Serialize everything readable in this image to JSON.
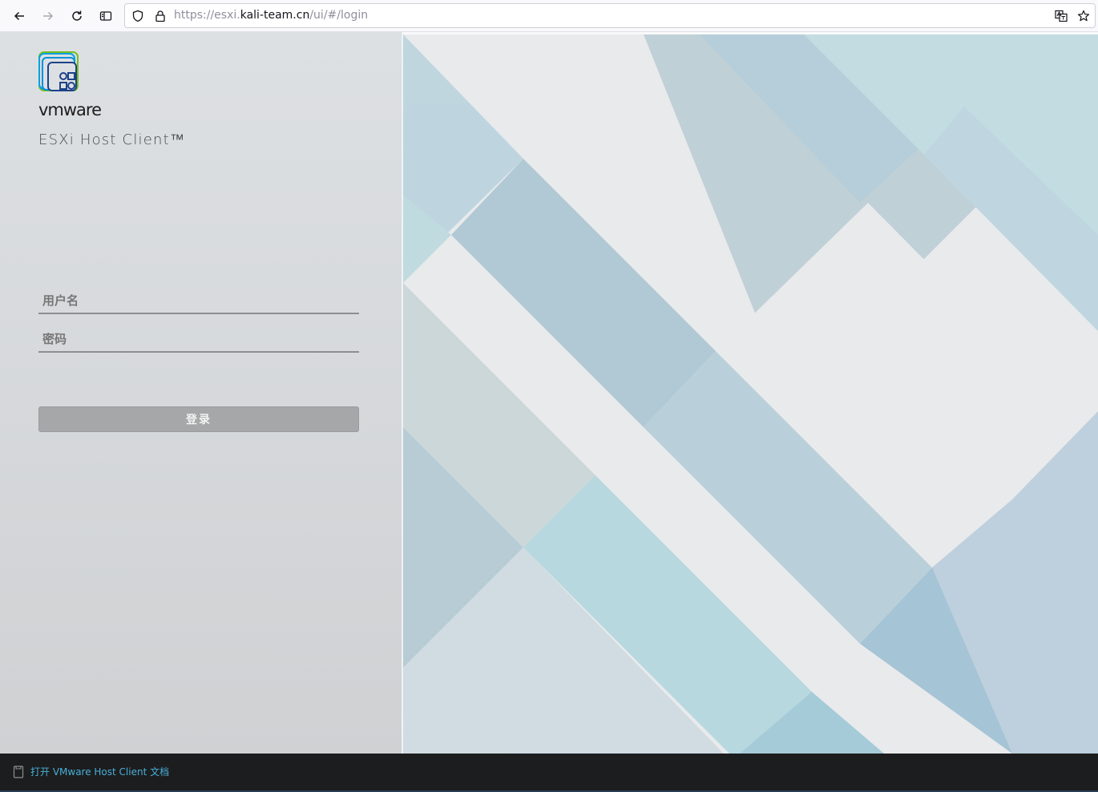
{
  "browser": {
    "url_prefix": "https://esxi.",
    "url_host": "kali-team.cn",
    "url_path": "/ui/#/login"
  },
  "login": {
    "brand": "vmware",
    "product": "ESXi Host Client™",
    "username_placeholder": "用户名",
    "password_placeholder": "密码",
    "login_label": "登录"
  },
  "footer": {
    "doc_link": "打开 VMware Host Client 文档"
  },
  "colors": {
    "link": "#49afd9",
    "button_disabled": "#a6a7a8",
    "footer_bg": "#1c1d1e"
  }
}
